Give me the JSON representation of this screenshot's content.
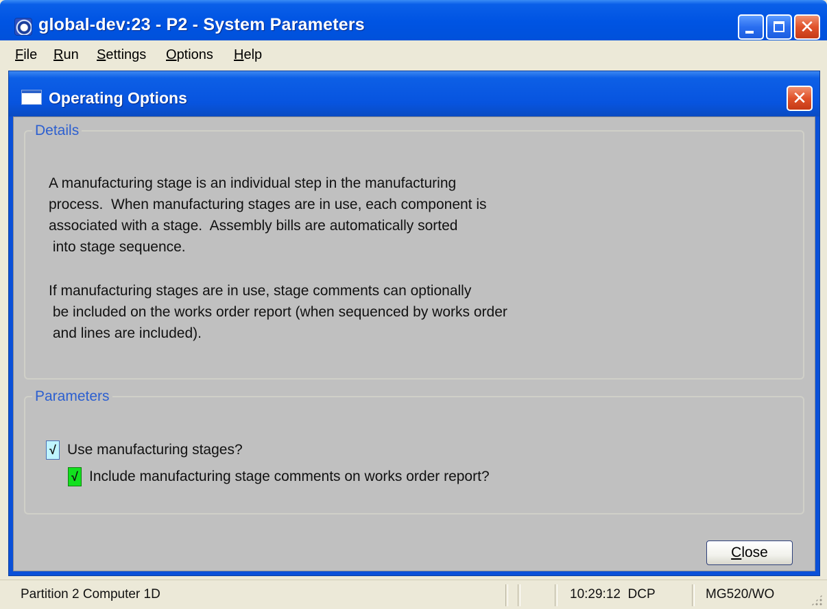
{
  "window": {
    "title": "global-dev:23 - P2 - System Parameters",
    "icon": "app-icon"
  },
  "menu": {
    "items": [
      {
        "label": "File",
        "accel": "F",
        "rest": "ile"
      },
      {
        "label": "Run",
        "accel": "R",
        "rest": "un"
      },
      {
        "label": "Settings",
        "accel": "S",
        "rest": "ettings"
      },
      {
        "label": "Options",
        "accel": "O",
        "rest": "ptions"
      },
      {
        "label": "Help",
        "accel": "H",
        "rest": "elp"
      }
    ]
  },
  "dialog": {
    "title": "Operating Options",
    "details": {
      "legend": "Details",
      "paragraph1": [
        "A manufacturing stage is an individual step in the manufacturing",
        "process.  When manufacturing stages are in use, each component is",
        "associated with a stage.  Assembly bills are automatically sorted",
        " into stage sequence."
      ],
      "paragraph2": [
        "If manufacturing stages are in use, stage comments can optionally",
        " be included on the works order report (when sequenced by works order",
        " and lines are included)."
      ]
    },
    "parameters": {
      "legend": "Parameters",
      "use_stages": {
        "label": "Use manufacturing stages?",
        "checked": true,
        "mark": "√"
      },
      "include_comments": {
        "label": "Include manufacturing stage comments on works order report?",
        "checked": true,
        "mark": "√"
      }
    },
    "close_button": {
      "label": "Close",
      "accel": "C",
      "rest": "lose"
    }
  },
  "statusbar": {
    "partition": "Partition 2 Computer 1D",
    "time": "10:29:12",
    "mode": "DCP",
    "program": "MG520/WO"
  }
}
